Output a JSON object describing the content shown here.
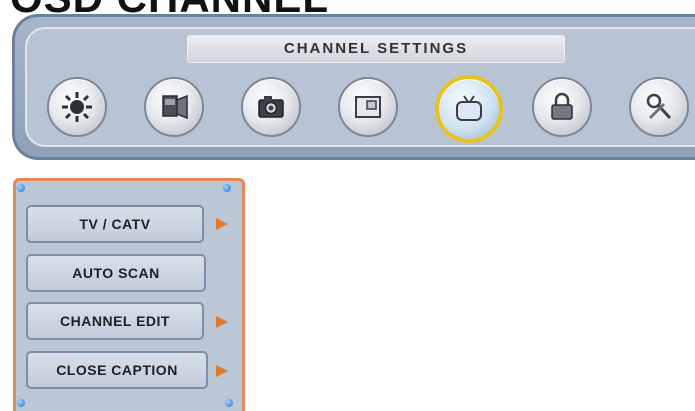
{
  "heading": {
    "text": "OSD CHANNEL"
  },
  "settings_bar": {
    "title": "CHANNEL SETTINGS",
    "icons": [
      {
        "name": "picture-settings-icon",
        "selected": false
      },
      {
        "name": "audio-settings-icon",
        "selected": false
      },
      {
        "name": "camera-icon",
        "selected": false
      },
      {
        "name": "display-settings-icon",
        "selected": false
      },
      {
        "name": "tv-channel-icon",
        "selected": true
      },
      {
        "name": "lock-icon",
        "selected": false
      },
      {
        "name": "setup-settings-icon",
        "selected": false
      }
    ]
  },
  "submenu": {
    "items": [
      {
        "label": "TV / CATV",
        "has_arrow": true
      },
      {
        "label": "AUTO SCAN",
        "has_arrow": false
      },
      {
        "label": "CHANNEL EDIT",
        "has_arrow": true
      },
      {
        "label": "CLOSE CAPTION",
        "has_arrow": true
      }
    ]
  },
  "colors": {
    "panel_blue": "#b8c4d3",
    "selection_yellow": "#e8c21d",
    "arrow_orange": "#e07a2e",
    "submenu_border": "#e48a5a"
  }
}
